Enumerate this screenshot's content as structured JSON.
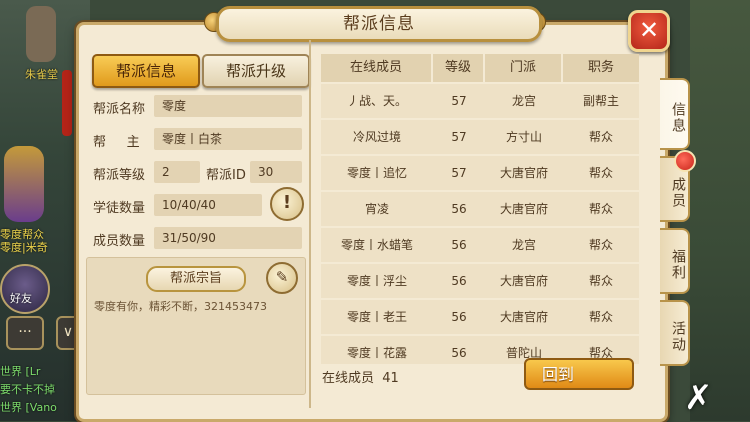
{
  "background": {
    "ally_name": "朱雀堂",
    "ally_tag_line1": "零度帮众",
    "ally_tag_line2": "零度|米奇",
    "friend_label": "好友",
    "chat_icon": "chat-bubble-icon",
    "world_lines": [
      "世界 [Lr",
      "要不卡不掉",
      "世界 [Vano"
    ]
  },
  "window": {
    "title": "帮派信息",
    "close_icon": "close-icon",
    "tabs": {
      "info": "帮派信息",
      "upgrade": "帮派升级"
    },
    "fields": {
      "name_label": "帮派名称",
      "name_value": "零度",
      "leader_label": "帮     主",
      "leader_value": "零度丨白茶",
      "level_label": "帮派等级",
      "level_value": "2",
      "id_label": "帮派ID",
      "id_value": "30",
      "apprentice_label": "学徒数量",
      "apprentice_value": "10/40/40",
      "member_label": "成员数量",
      "member_value": "31/50/90"
    },
    "alert_icon": "exclamation-icon",
    "motto": {
      "title": "帮派宗旨",
      "edit_icon": "brush-icon",
      "text": "零度有你，精彩不断，321453473"
    },
    "table": {
      "headers": [
        "在线成员",
        "等级",
        "门派",
        "职务"
      ],
      "rows": [
        [
          "丿战、天。",
          "57",
          "龙宫",
          "副帮主"
        ],
        [
          "冷风过境",
          "57",
          "方寸山",
          "帮众"
        ],
        [
          "零度丨追忆",
          "57",
          "大唐官府",
          "帮众"
        ],
        [
          "宵凌",
          "56",
          "大唐官府",
          "帮众"
        ],
        [
          "零度丨水蜡笔",
          "56",
          "龙宫",
          "帮众"
        ],
        [
          "零度丨浮尘",
          "56",
          "大唐官府",
          "帮众"
        ],
        [
          "零度丨老王",
          "56",
          "大唐官府",
          "帮众"
        ],
        [
          "零度丨花露",
          "56",
          "普陀山",
          "帮众"
        ]
      ]
    },
    "online_label": "在线成员",
    "online_count": "41",
    "back_button": "回到"
  },
  "side_tabs": [
    "信息",
    "成员",
    "福利",
    "活动"
  ],
  "colors": {
    "accent": "#e09a1c",
    "panel_bg": "#f4ead4",
    "border": "#c9a96a",
    "text": "#4f3a22",
    "badge_red": "#c8241a"
  }
}
